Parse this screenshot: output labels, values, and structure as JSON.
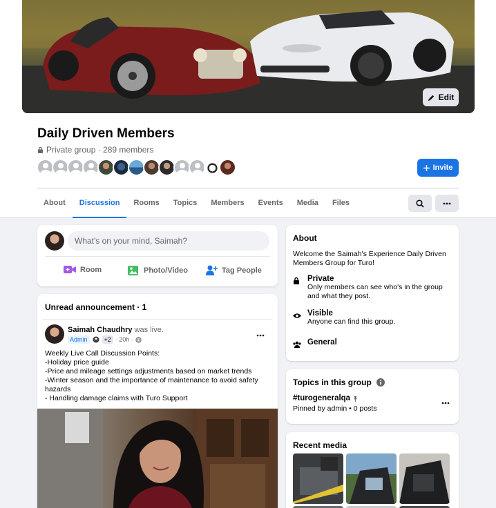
{
  "cover": {
    "edit_label": "Edit"
  },
  "group": {
    "title": "Daily Driven Members",
    "subtitle": "Private group · 289 members",
    "invite_label": "Invite"
  },
  "tabs": [
    "About",
    "Discussion",
    "Rooms",
    "Topics",
    "Members",
    "Events",
    "Media",
    "Files"
  ],
  "active_tab": "Discussion",
  "composer": {
    "placeholder": "What's on your mind, Saimah?",
    "actions": [
      "Room",
      "Photo/Video",
      "Tag People"
    ]
  },
  "announcement": {
    "title": "Unread announcement · 1",
    "author": "Saimah Chaudhry",
    "action": "was live.",
    "badge": "Admin",
    "extra": "+2",
    "time": "· 20h ·",
    "body": [
      "Weekly Live Call Discussion Points:",
      "-Holiday price guide",
      "-Price and mileage settings adjustments based on market trends",
      "-Winter season and the importance of maintenance to avoid safety hazards",
      "- Handling damage claims with Turo Support"
    ]
  },
  "about": {
    "title": "About",
    "description": "Welcome the Saimah's Experience Daily Driven Members Group for Turo!",
    "private_title": "Private",
    "private_desc": "Only members can see who's in the group and what they post.",
    "visible_title": "Visible",
    "visible_desc": "Anyone can find this group.",
    "general": "General"
  },
  "topics": {
    "title": "Topics in this group",
    "tag": "#turogeneralqa",
    "sub": "Pinned by admin • 0 posts"
  },
  "media": {
    "title": "Recent media"
  },
  "colors": {
    "accent": "#1b74e4",
    "page_bg": "#f0f2f5",
    "secondary_text": "#65676b"
  }
}
